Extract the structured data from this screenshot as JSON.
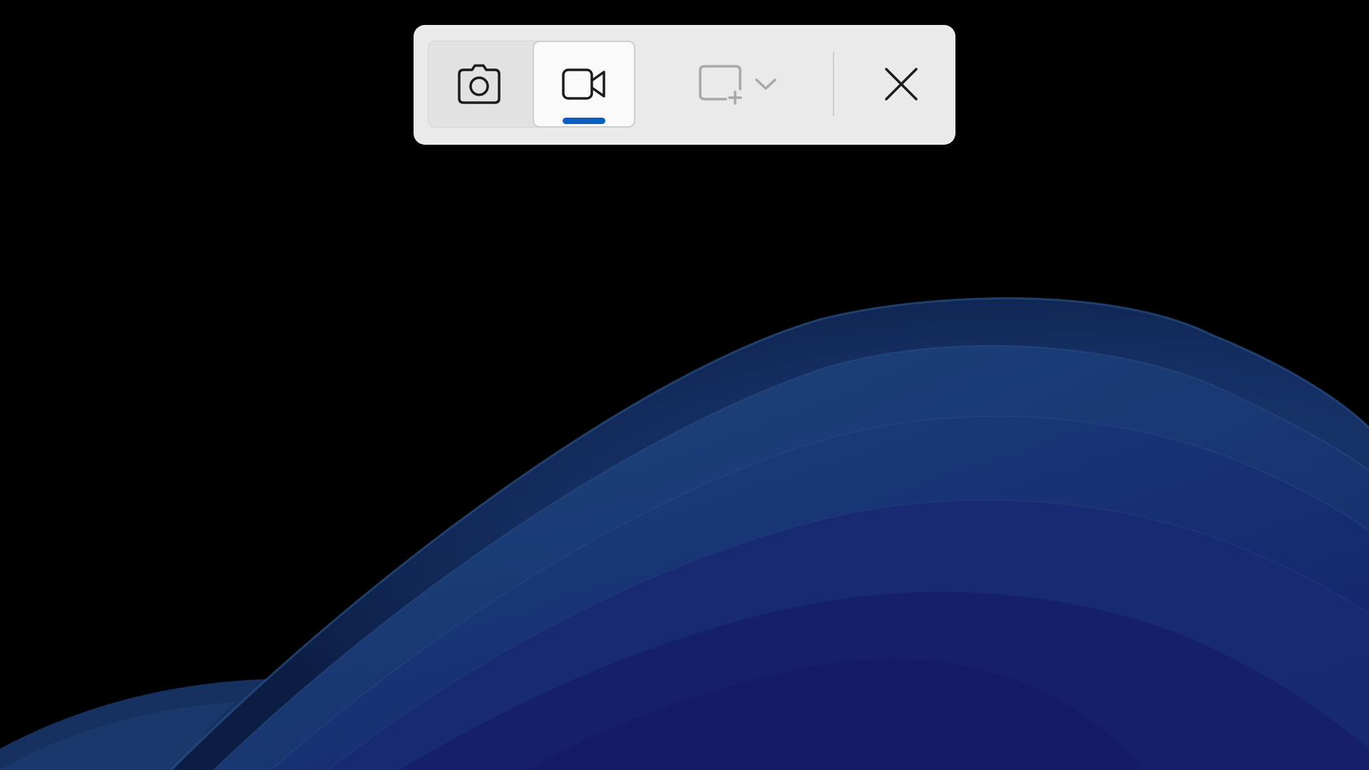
{
  "desktop": {
    "background_color": "#000000",
    "wallpaper": "windows-11-bloom-dark-blue"
  },
  "toolbar": {
    "background_color": "#eaeaea",
    "accent_color": "#0a5fc4",
    "modes": [
      {
        "id": "snip",
        "icon": "camera-icon",
        "selected": false
      },
      {
        "id": "record",
        "icon": "video-camera-icon",
        "selected": true
      }
    ],
    "shape_selector": {
      "icon": "rectangle-add-icon",
      "dropdown_icon": "chevron-down-icon",
      "enabled": false
    },
    "close": {
      "icon": "close-icon"
    }
  }
}
